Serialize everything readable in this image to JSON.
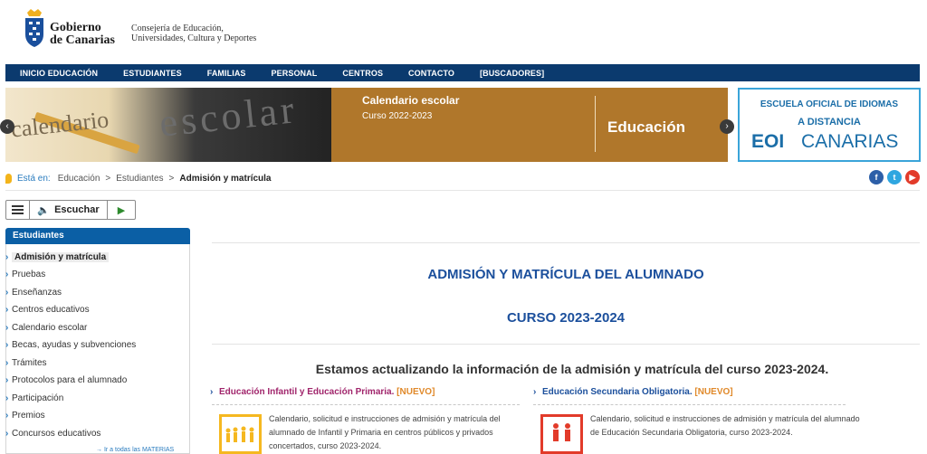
{
  "header": {
    "gov_name_line1": "Gobierno",
    "gov_name_line2": "de Canarias",
    "dept_line1": "Consejería de Educación,",
    "dept_line2": "Universidades, Cultura y Deportes"
  },
  "nav": {
    "items": [
      "INICIO EDUCACIÓN",
      "ESTUDIANTES",
      "FAMILIAS",
      "PERSONAL",
      "CENTROS",
      "CONTACTO",
      "[BUSCADORES]"
    ]
  },
  "banner": {
    "photo_word1": "calendario",
    "photo_word2": "escolar",
    "title": "Calendario escolar",
    "subtitle": "Curso 2022-2023",
    "section": "Educación"
  },
  "eoi": {
    "line1": "ESCUELA OFICIAL DE IDIOMAS",
    "line2": "A DISTANCIA",
    "brand_a": "EOI",
    "brand_b": "CANARIAS"
  },
  "breadcrumb": {
    "label": "Está en:",
    "items": [
      "Educación",
      "Estudiantes"
    ],
    "current": "Admisión y matrícula"
  },
  "social": {
    "facebook": "f",
    "twitter": "t",
    "youtube": "▶"
  },
  "listen": {
    "label": "Escuchar"
  },
  "sidebar": {
    "title": "Estudiantes",
    "items": [
      "Admisión y matrícula",
      "Pruebas",
      "Enseñanzas",
      "Centros educativos",
      "Calendario escolar",
      "Becas, ayudas y subvenciones",
      "Trámites",
      "Protocolos para el alumnado",
      "Participación",
      "Premios",
      "Concursos educativos"
    ],
    "all_link": "→ Ir a todas las MATERIAS"
  },
  "main": {
    "title": "ADMISIÓN Y MATRÍCULA DEL ALUMNADO",
    "course": "CURSO 2023-2024",
    "notice": "Estamos actualizando la información de la admisión y matrícula del curso 2023-2024.",
    "sections": [
      {
        "link": "Educación Infantil y Educación Primaria.",
        "badge": "[NUEVO]",
        "text": "Calendario, solicitud e instrucciones de admisión y matrícula del alumnado de Infantil y Primaria en centros públicos y privados concertados, curso 2023-2024."
      },
      {
        "link": "Educación Secundaria Obligatoria.",
        "badge": "[NUEVO]",
        "text": "Calendario, solicitud e instrucciones de admisión y matrícula del alumnado de Educación Secundaria Obligatoria, curso 2023-2024."
      }
    ]
  },
  "colors": {
    "nav_bg": "#0b3a6e",
    "banner_bg": "#b0772b",
    "title_blue": "#1b4f9c",
    "sidebar_head": "#0b5fa5",
    "badge_orange": "#e0892a",
    "link_magenta": "#a0246b"
  }
}
